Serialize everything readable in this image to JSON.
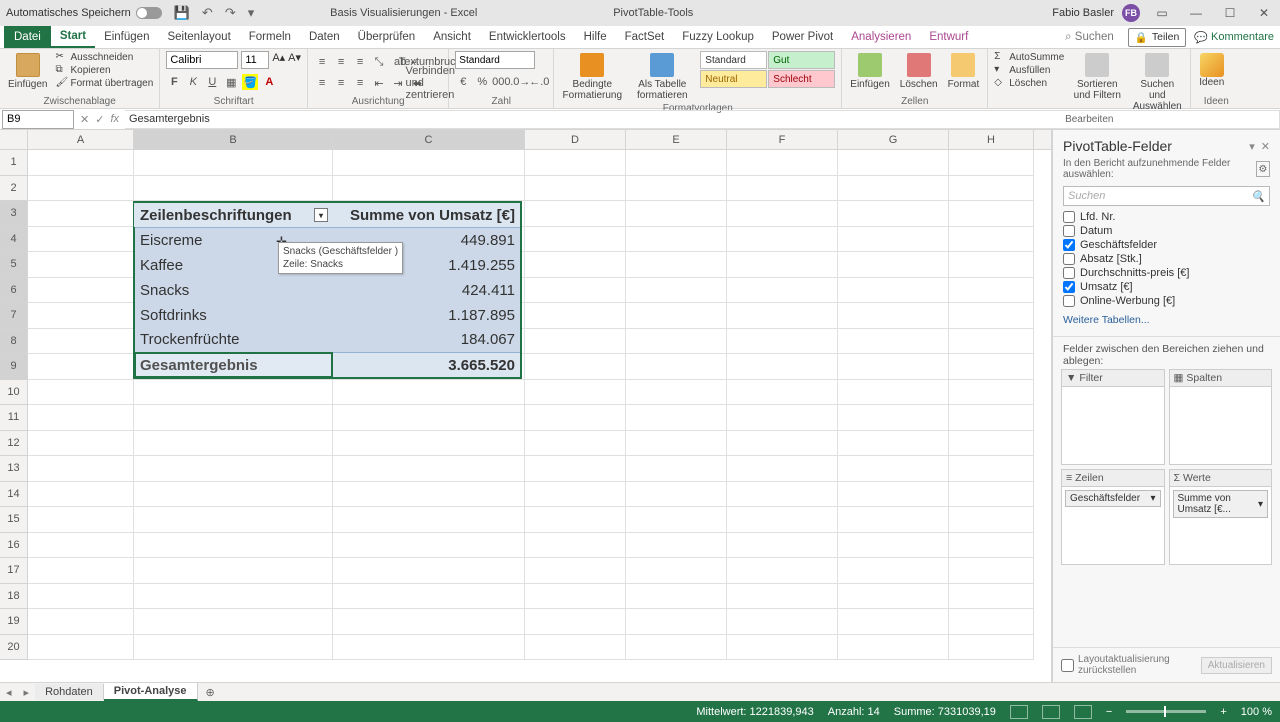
{
  "title": {
    "autosave": "Automatisches Speichern",
    "doc": "Basis Visualisierungen - Excel",
    "tool": "PivotTable-Tools",
    "user": "Fabio Basler",
    "initials": "FB"
  },
  "tabs": {
    "file": "Datei",
    "items": [
      "Start",
      "Einfügen",
      "Seitenlayout",
      "Formeln",
      "Daten",
      "Überprüfen",
      "Ansicht",
      "Entwicklertools",
      "Hilfe",
      "FactSet",
      "Fuzzy Lookup",
      "Power Pivot",
      "Analysieren",
      "Entwurf"
    ],
    "tell": "⌕ Suchen",
    "share": "Teilen",
    "comments": "Kommentare"
  },
  "ribbon": {
    "clipboard": {
      "paste": "Einfügen",
      "cut": "Ausschneiden",
      "copy": "Kopieren",
      "fmt": "Format übertragen",
      "label": "Zwischenablage"
    },
    "font": {
      "name": "Calibri",
      "size": "11",
      "label": "Schriftart"
    },
    "align": {
      "wrap": "Textumbruch",
      "merge": "Verbinden und zentrieren",
      "label": "Ausrichtung"
    },
    "number": {
      "fmt": "Standard",
      "label": "Zahl"
    },
    "styles": {
      "cond": "Bedingte Formatierung",
      "table": "Als Tabelle formatieren",
      "std": "Standard",
      "gut": "Gut",
      "neutral": "Neutral",
      "schlecht": "Schlecht",
      "label": "Formatvorlagen"
    },
    "cells": {
      "ins": "Einfügen",
      "del": "Löschen",
      "fmt": "Format",
      "label": "Zellen"
    },
    "editing": {
      "sum": "AutoSumme",
      "fill": "Ausfüllen",
      "clear": "Löschen",
      "sort": "Sortieren und Filtern",
      "find": "Suchen und Auswählen",
      "label": "Bearbeiten"
    },
    "ideas": {
      "btn": "Ideen",
      "label": "Ideen"
    }
  },
  "cellref": "B9",
  "formula": "Gesamtergebnis",
  "columns": [
    "A",
    "B",
    "C",
    "D",
    "E",
    "F",
    "G",
    "H"
  ],
  "pivot": {
    "headers": {
      "rows": "Zeilenbeschriftungen",
      "val": "Summe von Umsatz [€]"
    },
    "data": [
      {
        "label": "Eiscreme",
        "value": "449.891"
      },
      {
        "label": "Kaffee",
        "value": "1.419.255"
      },
      {
        "label": "Snacks",
        "value": "424.411"
      },
      {
        "label": "Softdrinks",
        "value": "1.187.895"
      },
      {
        "label": "Trockenfrüchte",
        "value": "184.067"
      }
    ],
    "total": {
      "label": "Gesamtergebnis",
      "value": "3.665.520"
    }
  },
  "tooltip": {
    "line1": "Snacks (Geschäftsfelder )",
    "line2": "Zeile: Snacks"
  },
  "sheets": {
    "tab1": "Rohdaten",
    "tab2": "Pivot-Analyse"
  },
  "fieldpane": {
    "title": "PivotTable-Felder",
    "sub": "In den Bericht aufzunehmende Felder auswählen:",
    "search": "Suchen",
    "fields": [
      {
        "name": "Lfd. Nr.",
        "checked": false
      },
      {
        "name": "Datum",
        "checked": false
      },
      {
        "name": "Geschäftsfelder",
        "checked": true
      },
      {
        "name": "Absatz [Stk.]",
        "checked": false
      },
      {
        "name": "Durchschnitts-preis [€]",
        "checked": false
      },
      {
        "name": "Umsatz [€]",
        "checked": true
      },
      {
        "name": "Online-Werbung [€]",
        "checked": false
      }
    ],
    "more": "Weitere Tabellen...",
    "dropLabel": "Felder zwischen den Bereichen ziehen und ablegen:",
    "areas": {
      "filter": "Filter",
      "cols": "Spalten",
      "rows": "Zeilen",
      "vals": "Werte"
    },
    "rowPill": "Geschäftsfelder",
    "valPill": "Summe von Umsatz [€...",
    "defer": "Layoutaktualisierung zurückstellen",
    "update": "Aktualisieren"
  },
  "status": {
    "avg": "Mittelwert: 1221839,943",
    "count": "Anzahl: 14",
    "sum": "Summe: 7331039,19",
    "zoom": "100 %"
  }
}
